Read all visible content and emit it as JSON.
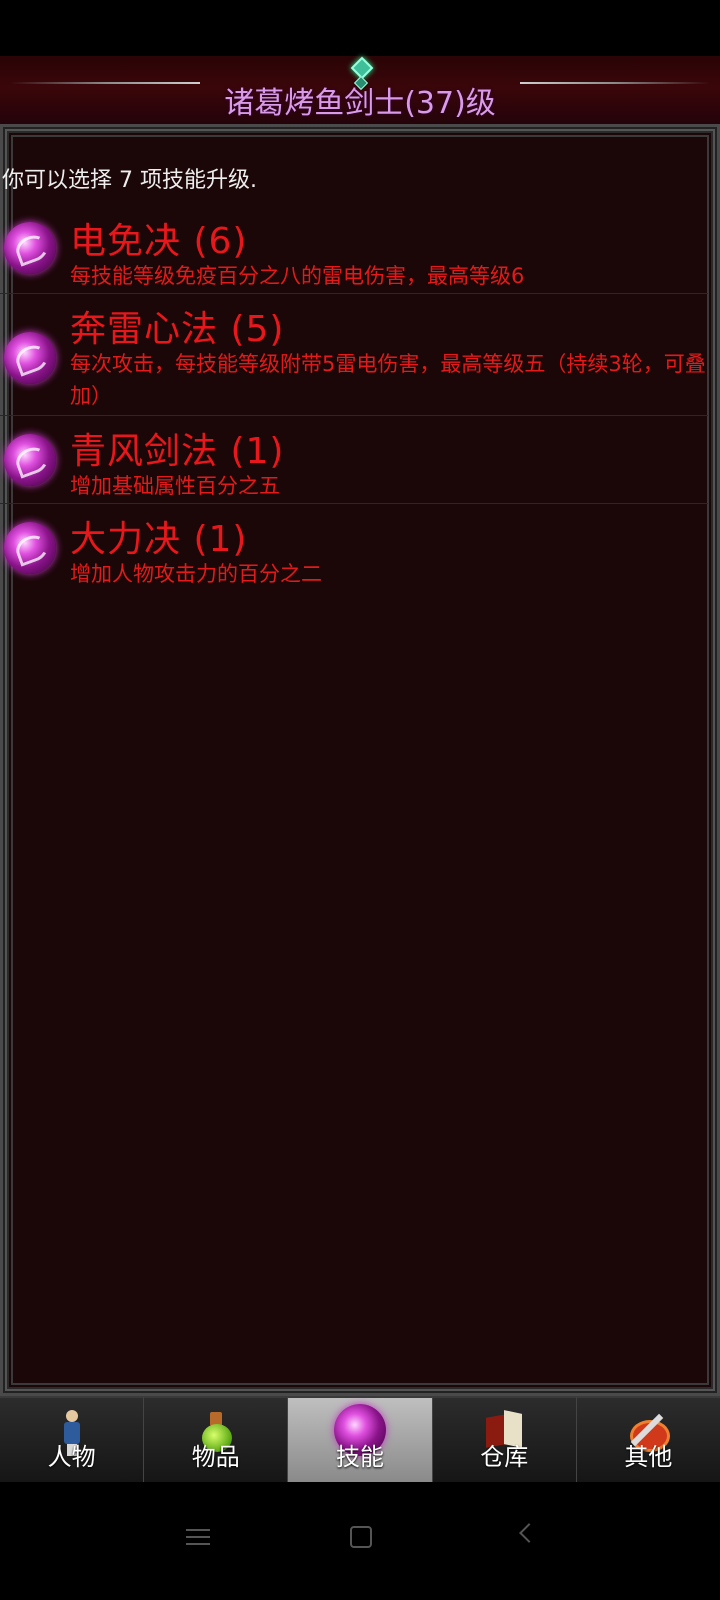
{
  "header": {
    "title": "诸葛烤鱼剑士(37)级"
  },
  "info": {
    "upgrade_text": "你可以选择 7 项技能升级."
  },
  "skills": [
    {
      "name": "电免决 (6)",
      "description": "每技能等级免疫百分之八的雷电伤害，最高等级6",
      "icon": "skill-orb-icon"
    },
    {
      "name": "奔雷心法 (5)",
      "description": "每次攻击，每技能等级附带5雷电伤害，最高等级五（持续3轮，可叠加）",
      "icon": "skill-orb-icon"
    },
    {
      "name": "青风剑法 (1)",
      "description": "增加基础属性百分之五",
      "icon": "skill-orb-icon"
    },
    {
      "name": "大力决 (1)",
      "description": "增加人物攻击力的百分之二",
      "icon": "skill-orb-icon"
    }
  ],
  "tabs": [
    {
      "label": "人物",
      "icon": "character-icon",
      "active": false
    },
    {
      "label": "物品",
      "icon": "potion-icon",
      "active": false
    },
    {
      "label": "技能",
      "icon": "skill-orb-icon",
      "active": true
    },
    {
      "label": "仓库",
      "icon": "warehouse-icon",
      "active": false
    },
    {
      "label": "其他",
      "icon": "other-icon",
      "active": false
    }
  ],
  "colors": {
    "title": "#d99ae8",
    "skill_text": "#e8171b",
    "panel_bg": "#1b0708",
    "active_tab": "#a8a8a8"
  }
}
